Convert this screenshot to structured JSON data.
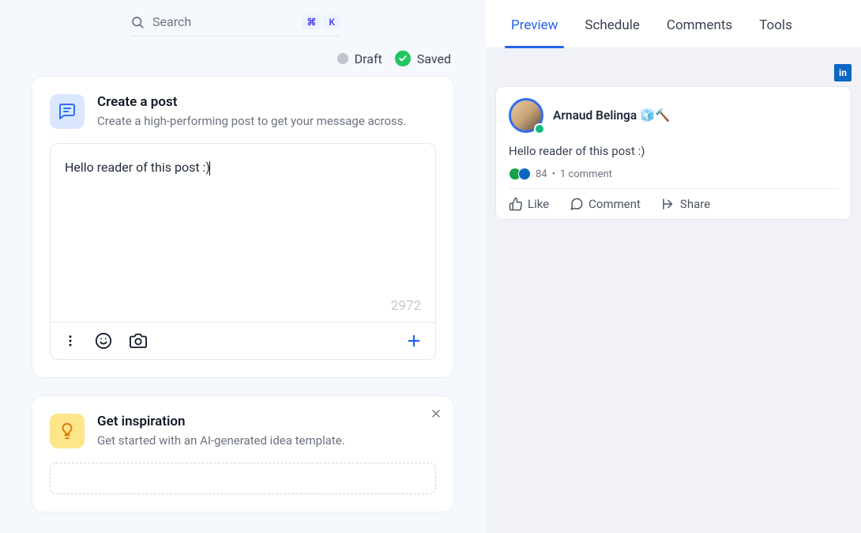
{
  "search": {
    "placeholder": "Search",
    "shortcut": [
      "⌘",
      "K"
    ]
  },
  "status": {
    "draft": "Draft",
    "saved": "Saved"
  },
  "createPost": {
    "title": "Create a post",
    "subtitle": "Create a high-performing post to get your message across.",
    "content": "Hello reader of this post :)",
    "charCount": "2972"
  },
  "inspiration": {
    "title": "Get inspiration",
    "subtitle": "Get started with an AI-generated idea template."
  },
  "tabs": {
    "preview": "Preview",
    "schedule": "Schedule",
    "comments": "Comments",
    "tools": "Tools"
  },
  "preview": {
    "badge": "in",
    "authorName": "Arnaud Belinga 🧊🔨",
    "postText": "Hello reader of this post :)",
    "engagementCount": "84",
    "engagementSep": "•",
    "commentCount": "1 comment",
    "actions": {
      "like": "Like",
      "comment": "Comment",
      "share": "Share"
    }
  }
}
